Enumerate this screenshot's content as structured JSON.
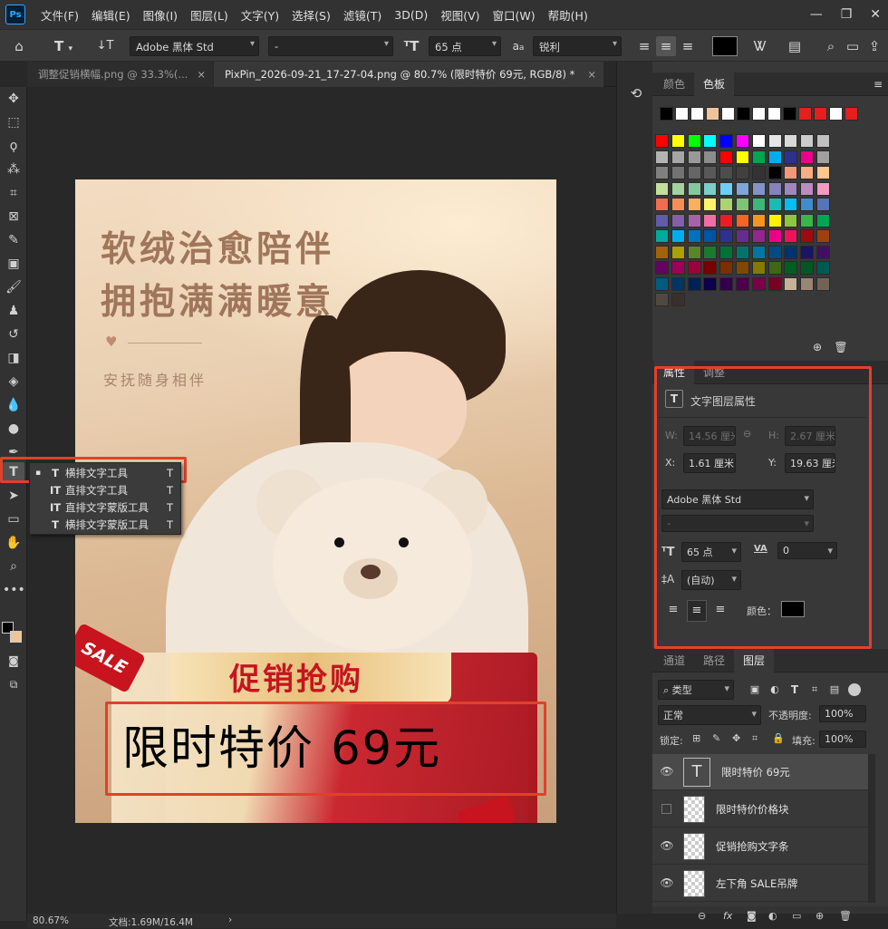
{
  "menubar": {
    "logo": "Ps",
    "items": [
      "文件(F)",
      "编辑(E)",
      "图像(I)",
      "图层(L)",
      "文字(Y)",
      "选择(S)",
      "滤镜(T)",
      "3D(D)",
      "视图(V)",
      "窗口(W)",
      "帮助(H)"
    ]
  },
  "options": {
    "font_family": "Adobe 黑体 Std",
    "font_style": "-",
    "font_size": "65 点",
    "aa_label": "a",
    "antialias": "锐利",
    "text_color": "#000000"
  },
  "tabs": [
    {
      "label": "调整促销横幅.png @ 33.3%(...",
      "close": "×"
    },
    {
      "label": "PixPin_2026-09-21_17-27-04.png @ 80.7% (限时特价 69元, RGB/8) *",
      "close": "×"
    }
  ],
  "poster": {
    "headline_1": "软绒治愈陪伴",
    "headline_2": "拥抱满满暖意",
    "subline": "安抚随身相伴",
    "sale_tag": "SALE",
    "banner_title": "促销抢购",
    "price_text": "限时特价 69元"
  },
  "flyout": {
    "items": [
      {
        "icon": "T",
        "label": "横排文字工具",
        "key": "T",
        "current": "▪"
      },
      {
        "icon": "IT",
        "label": "直排文字工具",
        "key": "T"
      },
      {
        "icon": "IT",
        "label": "直排文字蒙版工具",
        "key": "T"
      },
      {
        "icon": "T",
        "label": "横排文字蒙版工具",
        "key": "T"
      }
    ]
  },
  "swatch_panel": {
    "tabs": [
      "颜色",
      "色板"
    ],
    "recent": [
      "#000000",
      "#ffffff",
      "#ffffff",
      "#f0c39a",
      "#ffffff",
      "#000000",
      "#ffffff",
      "#ffffff",
      "#000000",
      "#e51e1e",
      "#e51e1e",
      "#ffffff",
      "#e51e1e"
    ],
    "grid": [
      [
        "#ff0000",
        "#ffff00",
        "#00ff00",
        "#00ffff",
        "#0000ff",
        "#ff00ff",
        "#ffffff",
        "#e6e6e6",
        "#d9d9d9",
        "#cccccc",
        "#bfbfbf"
      ],
      [
        "#b3b3b3",
        "#a6a6a6",
        "#999999",
        "#8c8c8c",
        "#ff0000",
        "#ffff00",
        "#00a650",
        "#00aeef",
        "#2e3192",
        "#ec008c",
        "#a0a0a0"
      ],
      [
        "#808080",
        "#737373",
        "#666666",
        "#595959",
        "#4d4d4d",
        "#404040",
        "#333333",
        "#000000",
        "#f7977a",
        "#fbad82",
        "#fdc68c"
      ],
      [
        "#c4df9b",
        "#a2d39c",
        "#82ca9c",
        "#7bcdc8",
        "#6dcff6",
        "#7da7d9",
        "#8393ca",
        "#8781bd",
        "#a186be",
        "#bd8cbf",
        "#f49ac1"
      ],
      [
        "#f26c4f",
        "#f68e56",
        "#fbaf5c",
        "#fff467",
        "#acd372",
        "#7cc576",
        "#3bb878",
        "#1abbb4",
        "#00bff3",
        "#438ccb",
        "#5574b9"
      ],
      [
        "#605ca8",
        "#855fa8",
        "#a763a9",
        "#ef6ea8",
        "#ed1c24",
        "#f26522",
        "#f7941d",
        "#fff200",
        "#8dc73f",
        "#39b54a",
        "#00a651"
      ],
      [
        "#00a99d",
        "#00aeef",
        "#0072bc",
        "#0054a6",
        "#2e3192",
        "#662d91",
        "#92278f",
        "#ec008c",
        "#ed145b",
        "#9e0b0f",
        "#a0410d"
      ],
      [
        "#a36209",
        "#aba000",
        "#598527",
        "#197b30",
        "#007236",
        "#00746b",
        "#0076a3",
        "#004b80",
        "#003471",
        "#1b1464",
        "#440e62"
      ],
      [
        "#630460",
        "#9e005d",
        "#9e0039",
        "#790000",
        "#7b2e00",
        "#7d4900",
        "#827b00",
        "#406618",
        "#005e20",
        "#005826",
        "#005952"
      ],
      [
        "#005b7f",
        "#003663",
        "#002157",
        "#0d004c",
        "#32004b",
        "#4b0049",
        "#7b0046",
        "#7a0026",
        "#c7b299",
        "#998675",
        "#736357"
      ],
      [
        "#534741",
        "#37302d"
      ]
    ]
  },
  "properties": {
    "tabs": [
      "属性",
      "调整"
    ],
    "header": "文字图层属性",
    "w_label": "W:",
    "w_value": "14.56 厘米",
    "h_label": "H:",
    "h_value": "2.67 厘米",
    "x_label": "X:",
    "x_value": "1.61 厘米",
    "y_label": "Y:",
    "y_value": "19.63 厘米",
    "font_family": "Adobe 黑体 Std",
    "font_style": "-",
    "font_size": "65 点",
    "tracking": "0",
    "tracking_icon": "VA",
    "leading": "(自动)",
    "color_label": "颜色：",
    "color_value": "#000000"
  },
  "layers_panel": {
    "tabs": [
      "通道",
      "路径",
      "图层"
    ],
    "filter_label": "类型",
    "blend_mode": "正常",
    "opacity_label": "不透明度:",
    "opacity_value": "100%",
    "lock_label": "锁定:",
    "fill_label": "填充:",
    "fill_value": "100%",
    "layers": [
      {
        "name": "限时特价 69元",
        "visible": true
      },
      {
        "name": "限时特价价格块",
        "visible": false
      },
      {
        "name": "促销抢购文字条",
        "visible": true
      },
      {
        "name": "左下角 SALE吊牌",
        "visible": true
      }
    ],
    "fx_label": "fx"
  },
  "status": {
    "zoom": "80.67%",
    "doc_info": "文档:1.69M/16.4M"
  }
}
